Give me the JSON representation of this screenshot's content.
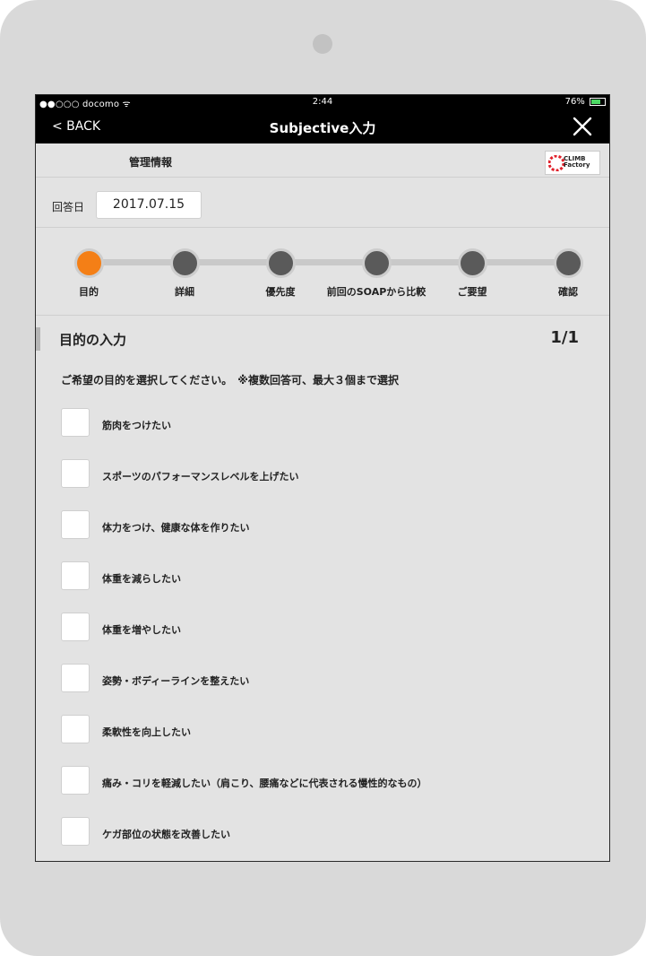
{
  "status_bar": {
    "carrier": "●●○○○ docomo ᯤ",
    "time": "2:44",
    "battery": "76%"
  },
  "nav": {
    "back_label": "< BACK",
    "title": "Subjective入力"
  },
  "management": {
    "label": "管理情報",
    "logo_text": "CLIMB Factory"
  },
  "answer_date": {
    "label": "回答日",
    "value": "2017.07.15"
  },
  "steps": [
    {
      "label": "目的",
      "active": true
    },
    {
      "label": "詳細",
      "active": false
    },
    {
      "label": "優先度",
      "active": false
    },
    {
      "label": "前回のSOAPから比較",
      "active": false
    },
    {
      "label": "ご要望",
      "active": false
    },
    {
      "label": "確認",
      "active": false
    }
  ],
  "section": {
    "title": "目的の入力",
    "page": "1/1",
    "instruction": "ご希望の目的を選択してください。　※複数回答可、最大３個まで選択"
  },
  "options": [
    "筋肉をつけたい",
    "スポーツのパフォーマンスレベルを上げたい",
    "体力をつけ、健康な体を作りたい",
    "体重を減らしたい",
    "体重を増やしたい",
    "姿勢・ボディーラインを整えたい",
    "柔軟性を向上したい",
    "痛み・コリを軽減したい（肩こり、腰痛などに代表される慢性的なもの）",
    "ケガ部位の状態を改善したい"
  ],
  "colors": {
    "active_step": "#f47f16",
    "inactive_step": "#5a5a5a",
    "navbar": "#000000"
  }
}
